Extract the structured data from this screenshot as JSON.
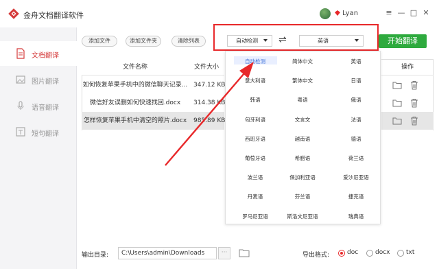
{
  "app": {
    "title": "金舟文档翻译软件",
    "username": "Lyan"
  },
  "window_controls": {
    "menu": "≡",
    "minimize": "—",
    "maximize": "□",
    "close": "✕"
  },
  "sidebar": {
    "items": [
      {
        "label": "文档翻译",
        "icon": "document-icon",
        "active": true
      },
      {
        "label": "图片翻译",
        "icon": "image-icon",
        "active": false
      },
      {
        "label": "语音翻译",
        "icon": "microphone-icon",
        "active": false
      },
      {
        "label": "短句翻译",
        "icon": "text-icon",
        "active": false
      }
    ]
  },
  "toolbar": {
    "add_file": "添加文件",
    "add_folder": "添加文件夹",
    "clear_list": "清除列表"
  },
  "lang": {
    "source": "自动检测",
    "swap": "⇌",
    "target": "英语"
  },
  "start_button": "开始翻译",
  "table": {
    "headers": {
      "name": "文件名称",
      "size": "文件大小",
      "ops": "操作"
    },
    "rows": [
      {
        "name": "如何恢复苹果手机中的微信聊天记录...",
        "size": "347.12 KB"
      },
      {
        "name": "微信好友误删如何快速找回.docx",
        "size": "314.38 KB"
      },
      {
        "name": "怎样恢复苹果手机中清空的照片.docx",
        "size": "985.89 KB"
      }
    ]
  },
  "languages": [
    "自动检测",
    "简体中文",
    "英语",
    "意大利语",
    "繁体中文",
    "日语",
    "韩语",
    "粤语",
    "俄语",
    "匈牙利语",
    "文言文",
    "法语",
    "西班牙语",
    "越南语",
    "德语",
    "葡萄牙语",
    "希腊语",
    "荷兰语",
    "波兰语",
    "保加利亚语",
    "爱沙尼亚语",
    "丹麦语",
    "芬兰语",
    "捷克语",
    "罗马尼亚语",
    "斯洛文尼亚语",
    "瑞典语"
  ],
  "output": {
    "label": "输出目录:",
    "path": "C:\\Users\\admin\\Downloads",
    "browse": "···"
  },
  "format": {
    "label": "导出格式:",
    "options": [
      "doc",
      "docx",
      "txt"
    ],
    "selected": "doc"
  },
  "colors": {
    "accent": "#d53a3a",
    "start": "#2eaa3e",
    "highlight_box": "#e8282a"
  }
}
